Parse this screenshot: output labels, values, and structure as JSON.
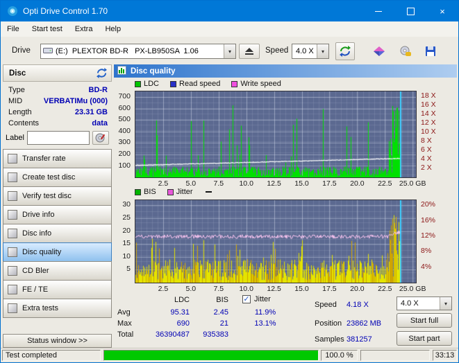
{
  "window": {
    "title": "Opti Drive Control 1.70"
  },
  "menu": {
    "items": [
      "File",
      "Start test",
      "Extra",
      "Help"
    ]
  },
  "toolbar": {
    "drive_label": "Drive",
    "drive_value": "(E:)  PLEXTOR BD-R   PX-LB950SA  1.06",
    "speed_label": "Speed",
    "speed_value": "4.0 X"
  },
  "sidebar": {
    "section_title": "Disc",
    "fields": [
      {
        "label": "Type",
        "value": "BD-R"
      },
      {
        "label": "MID",
        "value": "VERBATIMu (000)"
      },
      {
        "label": "Length",
        "value": "23.31 GB"
      },
      {
        "label": "Contents",
        "value": "data"
      }
    ],
    "label_field": {
      "label": "Label",
      "value": ""
    },
    "buttons": [
      "Transfer rate",
      "Create test disc",
      "Verify test disc",
      "Drive info",
      "Disc info",
      "Disc quality",
      "CD Bler",
      "FE / TE",
      "Extra tests"
    ],
    "active_button": "Disc quality",
    "status_window_label": "Status window >>"
  },
  "main": {
    "panel_title": "Disc quality",
    "top_chart": {
      "legend": [
        {
          "label": "LDC",
          "color": "#00c400"
        },
        {
          "label": "Read speed",
          "color": "#2830c8"
        },
        {
          "label": "Write speed",
          "color": "#f050e0"
        }
      ],
      "bg": "#5b6990",
      "y_left": {
        "ticks": [
          700,
          600,
          500,
          400,
          300,
          200,
          100
        ],
        "max": 750
      },
      "y_right": {
        "ticks": [
          "18 X",
          "16 X",
          "14 X",
          "12 X",
          "10 X",
          "8 X",
          "6 X",
          "4 X",
          "2 X"
        ],
        "max": 19,
        "color": "#8b1515"
      },
      "x_axis": {
        "max": 25.3,
        "ticks": [
          {
            "v": 2.5,
            "label": "2.5"
          },
          {
            "v": 5,
            "label": "5.0"
          },
          {
            "v": 7.5,
            "label": "7.5"
          },
          {
            "v": 10,
            "label": "10.0"
          },
          {
            "v": 12.5,
            "label": "12.5"
          },
          {
            "v": 15,
            "label": "15.0"
          },
          {
            "v": 17.5,
            "label": "17.5"
          },
          {
            "v": 20,
            "label": "20.0"
          },
          {
            "v": 22.5,
            "label": "22.5"
          },
          {
            "v": 25,
            "label": "25.0 GB"
          }
        ]
      },
      "data_end": 23.86,
      "end_marker_color": "#40d0ff",
      "series": [
        {
          "name": "LDC",
          "type": "bars",
          "color": "#00e000",
          "baseline": [
            5,
            95
          ],
          "spike_prob": 0.05,
          "spike": [
            120,
            520
          ],
          "tall_prob": 0.012,
          "tall": [
            450,
            700
          ],
          "cluster_start": 22.85,
          "cluster": [
            180,
            740
          ]
        },
        {
          "name": "Read speed",
          "type": "line",
          "color": "#ffffff",
          "start": 105,
          "end": 165,
          "noise": 2.5
        }
      ]
    },
    "bottom_chart": {
      "legend": [
        {
          "label": "BIS",
          "color": "#00b400"
        },
        {
          "label": "Jitter",
          "color": "#e858d8"
        }
      ],
      "bg": "#5b6990",
      "y_left": {
        "ticks": [
          30,
          25,
          20,
          15,
          10,
          5
        ],
        "max": 32
      },
      "y_right": {
        "ticks": [
          "20%",
          "16%",
          "12%",
          "8%",
          "4%"
        ],
        "max": 21.3,
        "color": "#8b1515"
      },
      "x_axis": {
        "max": 25.3,
        "ticks": [
          {
            "v": 2.5,
            "label": "2.5"
          },
          {
            "v": 5,
            "label": "5.0"
          },
          {
            "v": 7.5,
            "label": "7.5"
          },
          {
            "v": 10,
            "label": "10.0"
          },
          {
            "v": 12.5,
            "label": "12.5"
          },
          {
            "v": 15,
            "label": "15.0"
          },
          {
            "v": 17.5,
            "label": "17.5"
          },
          {
            "v": 20,
            "label": "20.0"
          },
          {
            "v": 22.5,
            "label": "22.5"
          },
          {
            "v": 25,
            "label": "25.0 GB"
          }
        ]
      },
      "data_end": 23.86,
      "end_marker_color": "#40d0ff",
      "series": [
        {
          "name": "BIS",
          "type": "bars",
          "color": "#e4e400",
          "color2": "#cfa400",
          "baseline": [
            1,
            9
          ],
          "spike_prob": 0.06,
          "spike": [
            9,
            17
          ],
          "cluster_start": 22.85,
          "cluster": [
            10,
            27
          ]
        },
        {
          "name": "Jitter",
          "type": "jitterline",
          "color": "#ffc8f4",
          "value": 11.9,
          "noise": 0.5,
          "end_value": 13.1
        }
      ]
    },
    "stats": {
      "columns": [
        "LDC",
        "BIS"
      ],
      "jitter_label": "Jitter",
      "jitter_checked": true,
      "rows": [
        {
          "label": "Avg",
          "ldc": "95.31",
          "bis": "2.45",
          "jitter": "11.9%"
        },
        {
          "label": "Max",
          "ldc": "690",
          "bis": "21",
          "jitter": "13.1%"
        },
        {
          "label": "Total",
          "ldc": "36390487",
          "bis": "935383",
          "jitter": ""
        }
      ],
      "speed_label": "Speed",
      "speed_value": "4.18 X",
      "speed_select": "4.0 X",
      "position_label": "Position",
      "position_value": "23862 MB",
      "samples_label": "Samples",
      "samples_value": "381257",
      "start_full_label": "Start full",
      "start_part_label": "Start part"
    }
  },
  "statusbar": {
    "text": "Test completed",
    "percent": "100.0 %",
    "time": "33:13",
    "progress_fraction": 1.0,
    "progress_color": "#00c800"
  }
}
